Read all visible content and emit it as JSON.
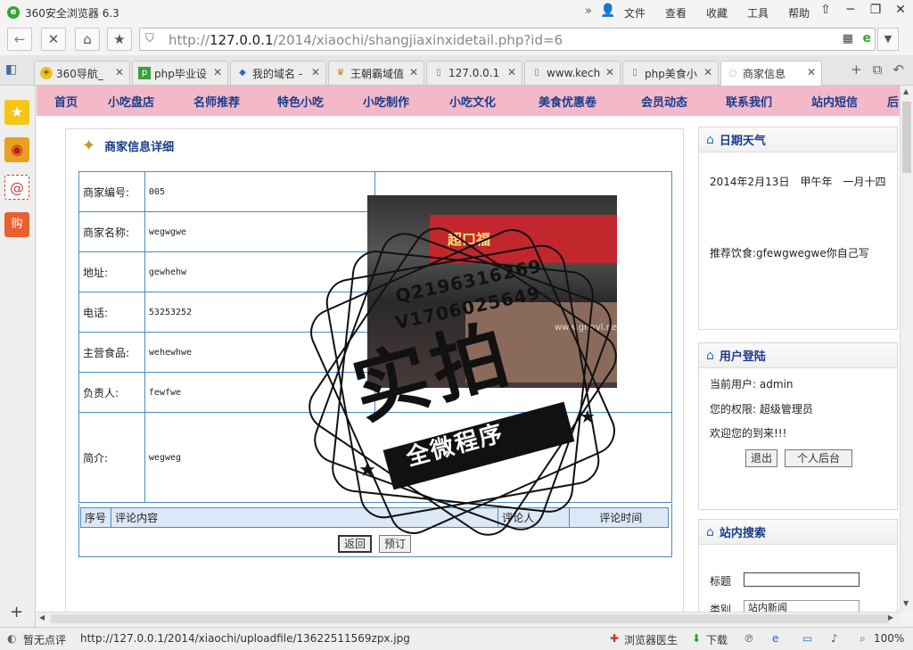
{
  "window": {
    "title": "360安全浏览器 6.3",
    "menus": [
      "文件",
      "查看",
      "收藏",
      "工具",
      "帮助"
    ]
  },
  "address": {
    "url_prefix": "http://",
    "url_host": "127.0.0.1",
    "url_path": "/2014/xiaochi/shangjiaxinxidetail.php?id=6"
  },
  "tabs": [
    {
      "label": "360导航_",
      "icon": "360-nav-icon"
    },
    {
      "label": "php毕业设",
      "icon": "php-icon"
    },
    {
      "label": "我的域名 -",
      "icon": "domain-icon"
    },
    {
      "label": "王朝霸域值",
      "icon": "crown-icon"
    },
    {
      "label": "127.0.0.1",
      "icon": "page-icon"
    },
    {
      "label": "www.kech",
      "icon": "page-icon"
    },
    {
      "label": "php美食小",
      "icon": "page-icon"
    },
    {
      "label": "商家信息",
      "icon": "loading-icon",
      "active": true
    }
  ],
  "site_nav": [
    "首页",
    "小吃盘店",
    "名师推荐",
    "特色小吃",
    "小吃制作",
    "小吃文化",
    "美食优惠卷",
    "会员动态",
    "联系我们",
    "站内短信",
    "后"
  ],
  "detail": {
    "title": "商家信息详细",
    "rows": [
      {
        "label": "商家编号:",
        "value": "005"
      },
      {
        "label": "商家名称:",
        "value": "wegwgwe"
      },
      {
        "label": "地址:",
        "value": "gewhehw"
      },
      {
        "label": "电话:",
        "value": "53253252"
      },
      {
        "label": "主营食品:",
        "value": "wehewhwe"
      },
      {
        "label": "负责人:",
        "value": "fewfwe"
      }
    ],
    "intro_label": "简介:",
    "intro_value": "wegweg",
    "comment_headers": [
      "序号",
      "评论内容",
      "评论人",
      "评论时间"
    ],
    "buttons": {
      "back": "返回",
      "reserve": "预订"
    }
  },
  "watermark": {
    "qq": "Q2196316269",
    "v": "V1706025649",
    "big": "实拍",
    "ribbon": "全微程序"
  },
  "photo": {
    "sign": "超口福",
    "www": "www.gnnyl.net"
  },
  "weather": {
    "title": "日期天气",
    "date": "2014年2月13日　甲午年　一月十四",
    "recommend": "推荐饮食:gfewgwegwe你自己写"
  },
  "login": {
    "title": "用户登陆",
    "current_user": "当前用户: admin",
    "permission": "您的权限: 超级管理员",
    "welcome": "欢迎您的到来!!!",
    "logout": "退出",
    "backend": "个人后台"
  },
  "search": {
    "title": "站内搜索",
    "title_label": "标题",
    "category_label": "类别",
    "category_value": "站内新闻"
  },
  "statusbar": {
    "rating": "暂无点评",
    "hover_url": "http://127.0.0.1/2014/xiaochi/uploadfile/13622511569zpx.jpg",
    "doctor": "浏览器医生",
    "download": "下载",
    "zoom": "100%"
  }
}
